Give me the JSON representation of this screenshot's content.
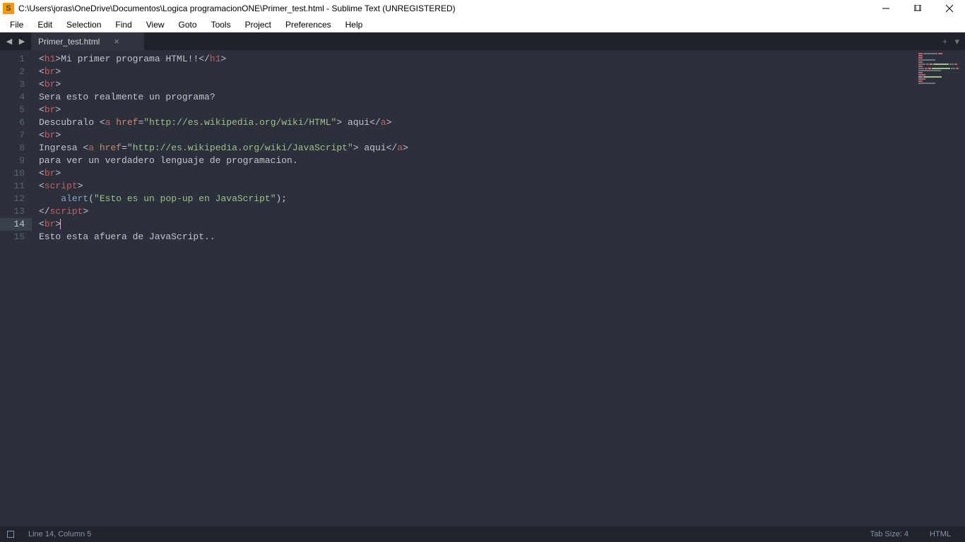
{
  "window": {
    "title": "C:\\Users\\joras\\OneDrive\\Documentos\\Logica programacionONE\\Primer_test.html - Sublime Text (UNREGISTERED)"
  },
  "menu": {
    "items": [
      "File",
      "Edit",
      "Selection",
      "Find",
      "View",
      "Goto",
      "Tools",
      "Project",
      "Preferences",
      "Help"
    ]
  },
  "tabs": {
    "active": "Primer_test.html"
  },
  "editor": {
    "active_line": 14,
    "lines": [
      {
        "n": 1,
        "tokens": [
          {
            "c": "pun",
            "t": "<"
          },
          {
            "c": "tag",
            "t": "h1"
          },
          {
            "c": "pun",
            "t": ">"
          },
          {
            "c": "txt",
            "t": "Mi primer programa HTML!!"
          },
          {
            "c": "pun",
            "t": "</"
          },
          {
            "c": "tag",
            "t": "h1"
          },
          {
            "c": "pun",
            "t": ">"
          }
        ]
      },
      {
        "n": 2,
        "tokens": [
          {
            "c": "pun",
            "t": "<"
          },
          {
            "c": "tag",
            "t": "br"
          },
          {
            "c": "pun",
            "t": ">"
          }
        ]
      },
      {
        "n": 3,
        "tokens": [
          {
            "c": "pun",
            "t": "<"
          },
          {
            "c": "tag",
            "t": "br"
          },
          {
            "c": "pun",
            "t": ">"
          }
        ]
      },
      {
        "n": 4,
        "tokens": [
          {
            "c": "txt",
            "t": "Sera esto realmente un programa?"
          }
        ]
      },
      {
        "n": 5,
        "tokens": [
          {
            "c": "pun",
            "t": "<"
          },
          {
            "c": "tag",
            "t": "br"
          },
          {
            "c": "pun",
            "t": ">"
          }
        ]
      },
      {
        "n": 6,
        "tokens": [
          {
            "c": "txt",
            "t": "Descubralo "
          },
          {
            "c": "pun",
            "t": "<"
          },
          {
            "c": "tag",
            "t": "a"
          },
          {
            "c": "txt",
            "t": " "
          },
          {
            "c": "attr",
            "t": "href"
          },
          {
            "c": "pun",
            "t": "="
          },
          {
            "c": "str",
            "t": "\"http://es.wikipedia.org/wiki/HTML\""
          },
          {
            "c": "pun",
            "t": ">"
          },
          {
            "c": "txt",
            "t": " aqui"
          },
          {
            "c": "pun",
            "t": "</"
          },
          {
            "c": "tag",
            "t": "a"
          },
          {
            "c": "pun",
            "t": ">"
          }
        ]
      },
      {
        "n": 7,
        "tokens": [
          {
            "c": "pun",
            "t": "<"
          },
          {
            "c": "tag",
            "t": "br"
          },
          {
            "c": "pun",
            "t": ">"
          }
        ]
      },
      {
        "n": 8,
        "tokens": [
          {
            "c": "txt",
            "t": "Ingresa "
          },
          {
            "c": "pun",
            "t": "<"
          },
          {
            "c": "tag",
            "t": "a"
          },
          {
            "c": "txt",
            "t": " "
          },
          {
            "c": "attr",
            "t": "href"
          },
          {
            "c": "pun",
            "t": "="
          },
          {
            "c": "str",
            "t": "\"http://es.wikipedia.org/wiki/JavaScript\""
          },
          {
            "c": "pun",
            "t": ">"
          },
          {
            "c": "txt",
            "t": " aqui"
          },
          {
            "c": "pun",
            "t": "</"
          },
          {
            "c": "tag",
            "t": "a"
          },
          {
            "c": "pun",
            "t": ">"
          }
        ]
      },
      {
        "n": 9,
        "tokens": [
          {
            "c": "txt",
            "t": "para ver un verdadero lenguaje de programacion."
          }
        ]
      },
      {
        "n": 10,
        "tokens": [
          {
            "c": "pun",
            "t": "<"
          },
          {
            "c": "tag",
            "t": "br"
          },
          {
            "c": "pun",
            "t": ">"
          }
        ]
      },
      {
        "n": 11,
        "tokens": [
          {
            "c": "pun",
            "t": "<"
          },
          {
            "c": "tag",
            "t": "script"
          },
          {
            "c": "pun",
            "t": ">"
          }
        ]
      },
      {
        "n": 12,
        "tokens": [
          {
            "c": "txt",
            "t": "    "
          },
          {
            "c": "fn",
            "t": "alert"
          },
          {
            "c": "pun",
            "t": "("
          },
          {
            "c": "str",
            "t": "\"Esto es un pop-up en JavaScript\""
          },
          {
            "c": "pun",
            "t": ");"
          }
        ]
      },
      {
        "n": 13,
        "tokens": [
          {
            "c": "pun",
            "t": "</"
          },
          {
            "c": "tag",
            "t": "script"
          },
          {
            "c": "pun",
            "t": ">"
          }
        ]
      },
      {
        "n": 14,
        "tokens": [
          {
            "c": "pun",
            "t": "<"
          },
          {
            "c": "tag",
            "t": "br"
          },
          {
            "c": "pun",
            "t": ">"
          }
        ],
        "caret_after": true
      },
      {
        "n": 15,
        "tokens": [
          {
            "c": "txt",
            "t": "Esto esta afuera de JavaScript.."
          }
        ]
      }
    ]
  },
  "status": {
    "position": "Line 14, Column 5",
    "tab_size": "Tab Size: 4",
    "syntax": "HTML"
  }
}
